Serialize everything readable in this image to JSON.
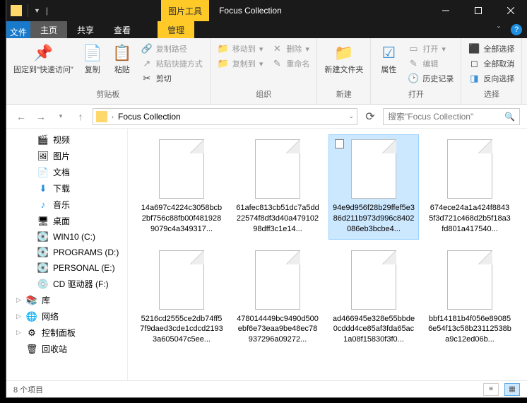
{
  "title_contextual": "图片工具",
  "window_title": "Focus Collection",
  "tabs": {
    "file": "文件",
    "home": "主页",
    "share": "共享",
    "view": "查看",
    "manage": "管理"
  },
  "ribbon": {
    "pin": "固定到\"快速访问\"",
    "copy": "复制",
    "paste": "粘贴",
    "copy_path": "复制路径",
    "paste_shortcut": "粘贴快捷方式",
    "cut": "剪切",
    "group_clip": "剪贴板",
    "move_to": "移动到",
    "copy_to": "复制到",
    "delete": "删除",
    "rename": "重命名",
    "group_org": "组织",
    "new_folder": "新建文件夹",
    "group_new": "新建",
    "properties": "属性",
    "open": "打开",
    "edit": "编辑",
    "history": "历史记录",
    "group_open": "打开",
    "select_all": "全部选择",
    "select_none": "全部取消",
    "invert": "反向选择",
    "group_select": "选择"
  },
  "breadcrumb": "Focus Collection",
  "search_placeholder": "搜索\"Focus Collection\"",
  "sidebar": [
    {
      "key": "videos",
      "label": "视频",
      "level": 1
    },
    {
      "key": "pictures",
      "label": "图片",
      "level": 1
    },
    {
      "key": "documents",
      "label": "文档",
      "level": 1
    },
    {
      "key": "downloads",
      "label": "下载",
      "level": 1
    },
    {
      "key": "music",
      "label": "音乐",
      "level": 1
    },
    {
      "key": "desktop",
      "label": "桌面",
      "level": 1
    },
    {
      "key": "c",
      "label": "WIN10 (C:)",
      "level": 1
    },
    {
      "key": "d",
      "label": "PROGRAMS (D:)",
      "level": 1
    },
    {
      "key": "e",
      "label": "PERSONAL (E:)",
      "level": 1
    },
    {
      "key": "f",
      "label": "CD 驱动器 (F:)",
      "level": 1
    },
    {
      "key": "lib",
      "label": "库",
      "level": 0,
      "expand": true
    },
    {
      "key": "net",
      "label": "网络",
      "level": 0,
      "expand": true
    },
    {
      "key": "cpl",
      "label": "控制面板",
      "level": 0,
      "expand": true
    },
    {
      "key": "bin",
      "label": "回收站",
      "level": 0
    }
  ],
  "files": [
    {
      "name": "14a697c4224c3058bcb2bf756c88fb00f4819289079c4a349317...",
      "sel": false
    },
    {
      "name": "61afec813cb51dc7a5dd22574f8df3d40a47910298dff3c1e14...",
      "sel": false
    },
    {
      "name": "94e9d956f28b29ffef5e386d211b973d996c8402086eb3bcbe4...",
      "sel": true
    },
    {
      "name": "674ece24a1a424f88435f3d721c468d2b5f18a3fd801a417540...",
      "sel": false
    },
    {
      "name": "5216cd2555ce2db74ff57f9daed3cde1cdcd21933a605047c5ee...",
      "sel": false
    },
    {
      "name": "478014449bc9490d500ebf6e73eaa9be48ec78937296a09272...",
      "sel": false
    },
    {
      "name": "ad466945e328e55bbde0cddd4ce85af3fda65ac1a08f15830f3f0...",
      "sel": false
    },
    {
      "name": "bbf14181b4f056e890856e54f13c58b23112538ba9c12ed06b...",
      "sel": false
    }
  ],
  "status_text": "8 个项目"
}
